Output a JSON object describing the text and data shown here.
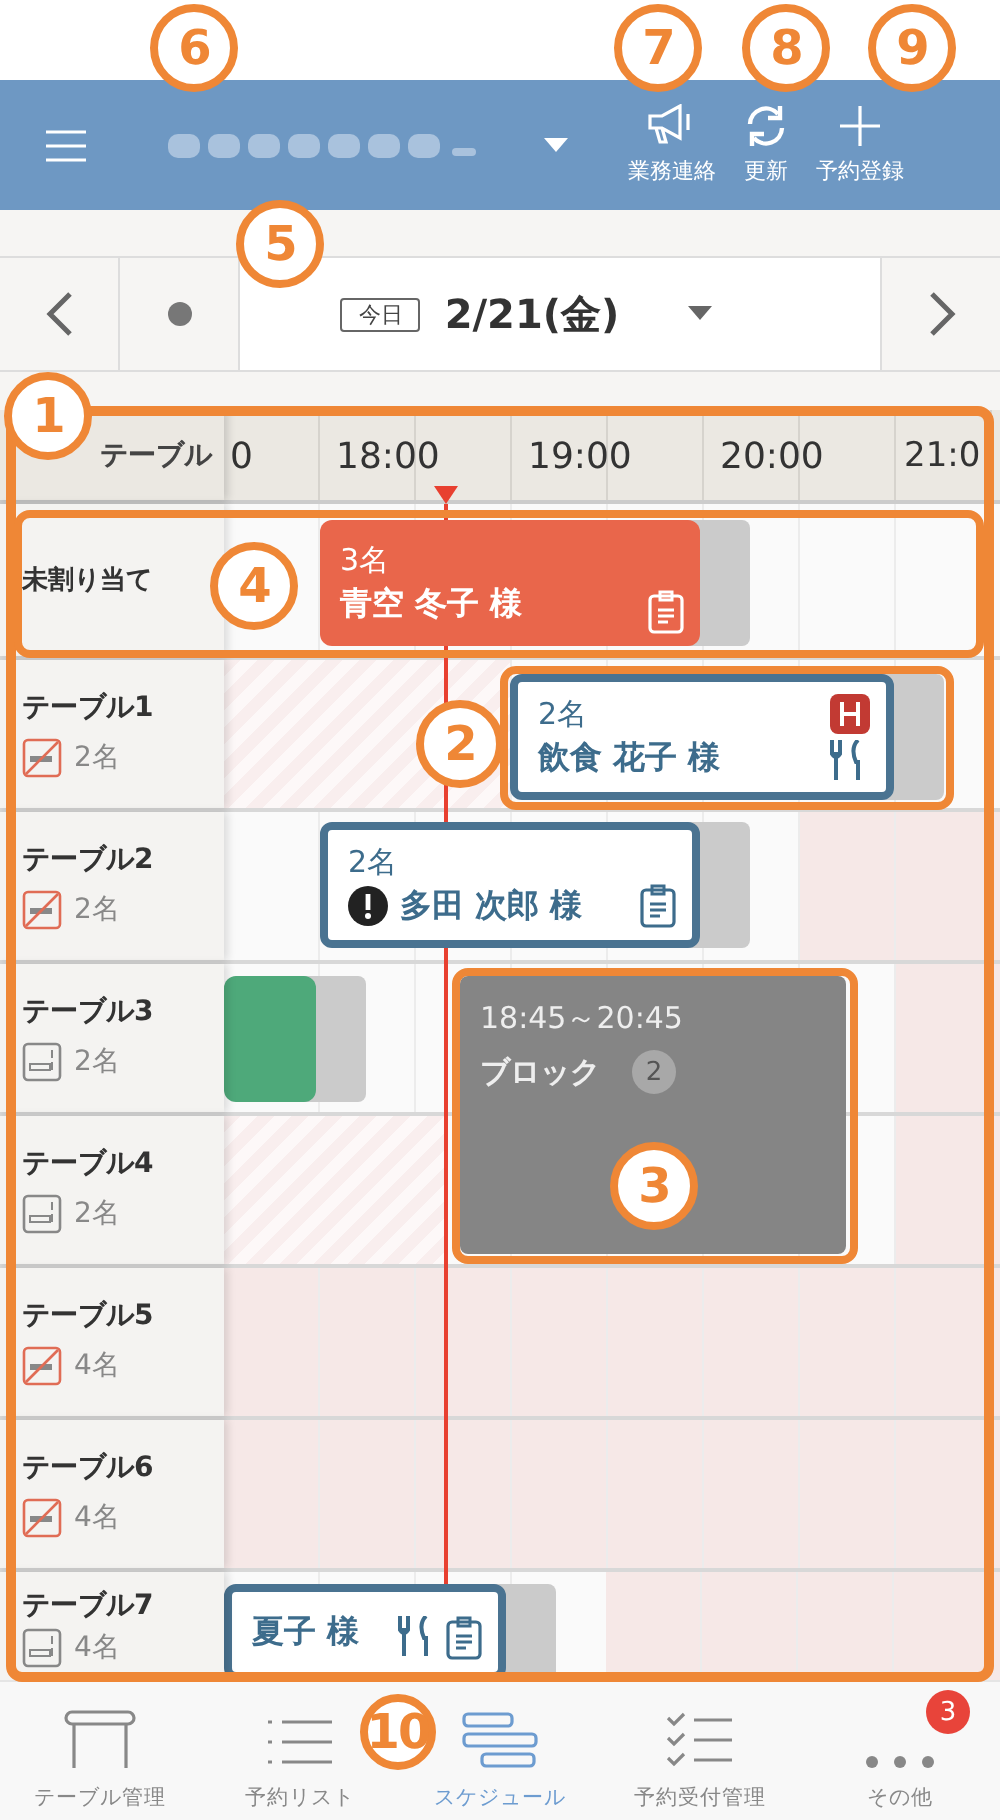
{
  "header": {
    "actions": [
      {
        "kind": "announce",
        "label": "業務連絡"
      },
      {
        "kind": "refresh",
        "label": "更新"
      },
      {
        "kind": "add",
        "label": "予約登録"
      }
    ]
  },
  "date_bar": {
    "today_badge": "今日",
    "date": "2/21(金)"
  },
  "schedule": {
    "corner": "テーブル",
    "time_labels": [
      "0",
      "18:00",
      "19:00",
      "20:00",
      "21:0"
    ],
    "unassigned_label": "未割り当て",
    "tables": [
      {
        "name": "テーブル1",
        "smoking": false,
        "capacity": "2名"
      },
      {
        "name": "テーブル2",
        "smoking": false,
        "capacity": "2名"
      },
      {
        "name": "テーブル3",
        "smoking": true,
        "capacity": "2名"
      },
      {
        "name": "テーブル4",
        "smoking": true,
        "capacity": "2名"
      },
      {
        "name": "テーブル5",
        "smoking": false,
        "capacity": "4名"
      },
      {
        "name": "テーブル6",
        "smoking": false,
        "capacity": "4名"
      },
      {
        "name": "テーブル7",
        "smoking": true,
        "capacity": "4名"
      }
    ],
    "bookings": [
      {
        "kind": "unassigned",
        "party": "3名",
        "name": "青空 冬子 様",
        "memo": true,
        "meal": false,
        "course": false,
        "alert": false
      },
      {
        "kind": "reserved",
        "party": "2名",
        "name": "飲食 花子 様",
        "memo": false,
        "meal": true,
        "course": true,
        "alert": false
      },
      {
        "kind": "reserved",
        "party": "2名",
        "name": "多田 次郎 様",
        "memo": true,
        "meal": false,
        "course": false,
        "alert": true
      },
      {
        "kind": "seated"
      },
      {
        "kind": "reserved",
        "name": "夏子 様",
        "memo": true,
        "meal": true,
        "course": false,
        "alert": false
      }
    ],
    "block": {
      "time": "18:45～20:45",
      "label": "ブロック",
      "count": "2"
    }
  },
  "nav": [
    {
      "kind": "table",
      "label": "テーブル管理",
      "selected": false
    },
    {
      "kind": "list",
      "label": "予約リスト",
      "selected": false
    },
    {
      "kind": "schedule",
      "label": "スケジュール",
      "selected": true
    },
    {
      "kind": "checklist",
      "label": "予約受付管理",
      "selected": false
    },
    {
      "kind": "more",
      "label": "その他",
      "selected": false,
      "badge": "3"
    }
  ],
  "callouts": [
    "1",
    "2",
    "3",
    "4",
    "5",
    "6",
    "7",
    "8",
    "9",
    "10"
  ]
}
